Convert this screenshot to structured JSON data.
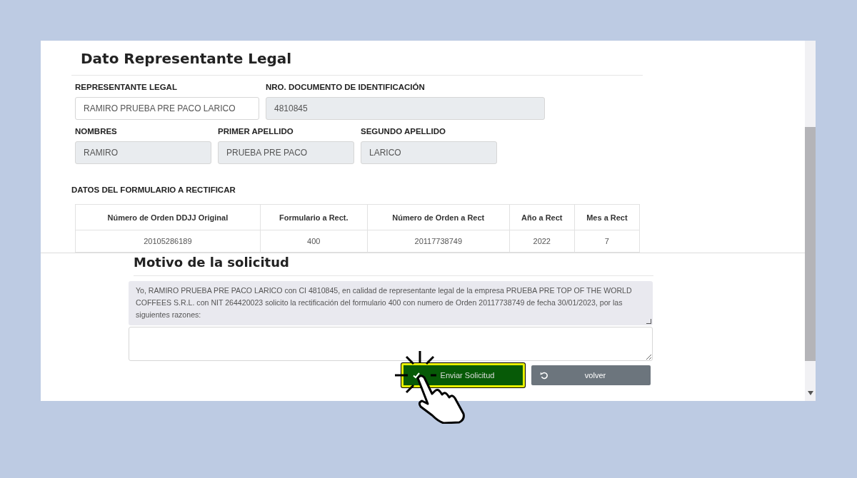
{
  "section_title": "Dato Representante Legal",
  "field_rows": [
    [
      {
        "label": "REPRESENTANTE LEGAL",
        "value": "RAMIRO PRUEBA PRE PACO LARICO",
        "disabled": false
      },
      {
        "label": "NRO. DOCUMENTO DE IDENTIFICACIÓN",
        "value": "4810845",
        "disabled": true
      }
    ],
    [
      {
        "label": "NOMBRES",
        "value": "RAMIRO",
        "disabled": true
      },
      {
        "label": "PRIMER APELLIDO",
        "value": "PRUEBA PRE PACO",
        "disabled": true
      },
      {
        "label": "SEGUNDO APELLIDO",
        "value": "LARICO",
        "disabled": true
      }
    ]
  ],
  "table_title": "DATOS DEL FORMULARIO A RECTIFICAR",
  "table": {
    "columns": [
      "Número de Orden DDJJ Original",
      "Formulario a Rect.",
      "Número de Orden a Rect",
      "Año a Rect",
      "Mes a Rect"
    ],
    "rows": [
      [
        "20105286189",
        "400",
        "20117738749",
        "2022",
        "7"
      ]
    ]
  },
  "motivo": {
    "title": "Motivo de la solicitud",
    "message": "Yo, RAMIRO PRUEBA PRE PACO LARICO con CI 4810845, en calidad de representante legal de la empresa PRUEBA PRE TOP OF THE WORLD COFFEES S.R.L. con NIT 264420023 solicito la rectificación del formulario 400 con numero de Orden 20117738749 de fecha 30/01/2023, por las siguientes razones:"
  },
  "buttons": [
    {
      "label": "Enviar Solicitud",
      "kind": "submit",
      "highlighted": true
    },
    {
      "label": "volver",
      "kind": "back",
      "highlighted": false
    }
  ]
}
